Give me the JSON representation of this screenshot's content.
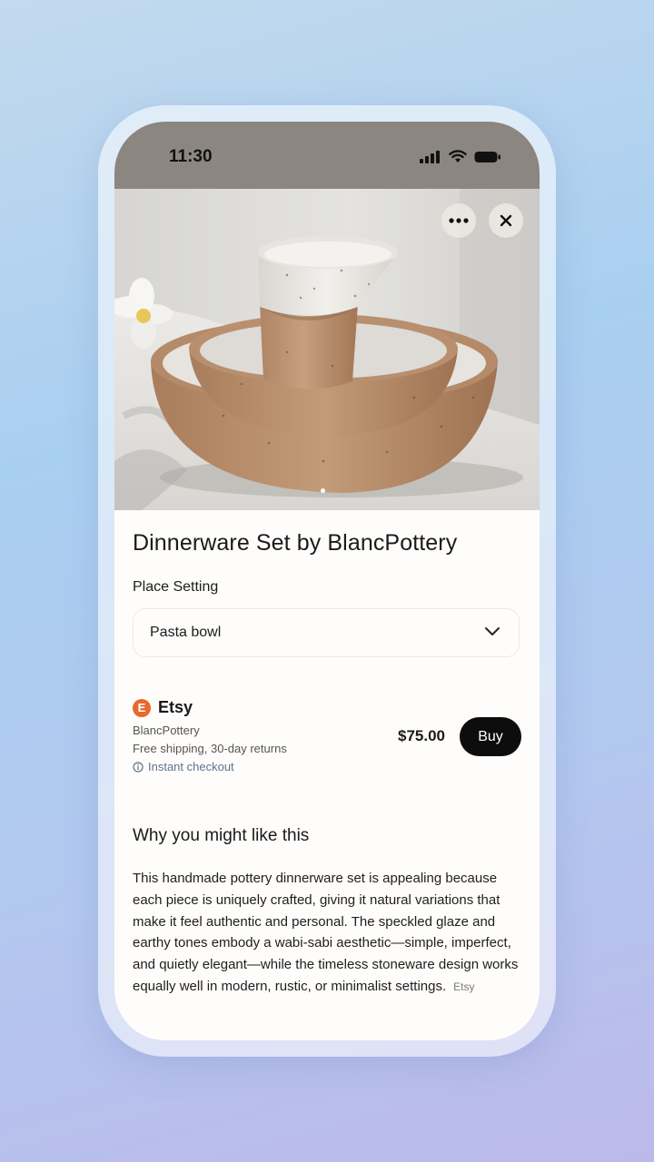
{
  "status_bar": {
    "time": "11:30",
    "icons": [
      "signal-icon",
      "wifi-icon",
      "battery-icon"
    ]
  },
  "hero": {
    "image_description": "product-photo",
    "more_icon": "more-icon",
    "close_icon": "close-icon"
  },
  "product": {
    "title": "Dinnerware Set by BlancPottery",
    "option_label": "Place Setting",
    "option_value": "Pasta bowl"
  },
  "offer": {
    "merchant_logo_letter": "E",
    "merchant": "Etsy",
    "seller": "BlancPottery",
    "shipping": "Free shipping, 30-day returns",
    "checkout": "Instant checkout",
    "price": "$75.00",
    "buy_label": "Buy",
    "accent_color": "#e8692c"
  },
  "why": {
    "heading": "Why you might like this",
    "body": "This handmade pottery dinnerware set is appealing because each piece is uniquely crafted, giving it natural variations that make it feel authentic and personal. The speckled glaze and earthy tones embody a wabi-sabi aesthetic—simple, imperfect, and quietly elegant—while the timeless stoneware design works equally well in modern, rustic, or minimalist settings.",
    "source": "Etsy"
  }
}
